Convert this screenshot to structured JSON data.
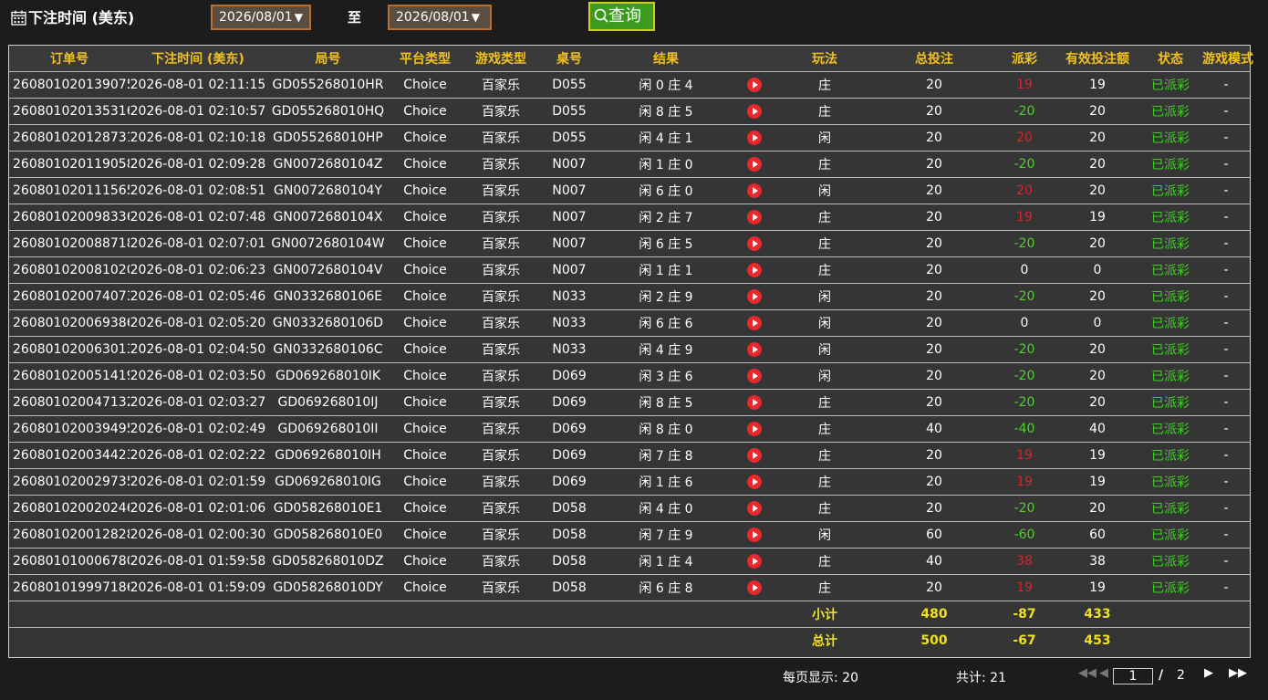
{
  "filter": {
    "label": "下注时间 (美东)",
    "start_date": "2026/08/01",
    "to_label": "至",
    "end_date": "2026/08/01",
    "query_label": "查询"
  },
  "table": {
    "headers": [
      "订单号",
      "下注时间 (美东)",
      "局号",
      "平台类型",
      "游戏类型",
      "桌号",
      "结果",
      "",
      "玩法",
      "总投注",
      "派彩",
      "有效投注额",
      "状态",
      "游戏模式"
    ],
    "rows": [
      [
        "260801020139075",
        "2026-08-01 02:11:15",
        "GD055268010HR",
        "Choice",
        "百家乐",
        "D055",
        "闲 0 庄 4",
        "",
        "庄",
        "20",
        "19",
        "19",
        "已派彩",
        "-"
      ],
      [
        "260801020135316",
        "2026-08-01 02:10:57",
        "GD055268010HQ",
        "Choice",
        "百家乐",
        "D055",
        "闲 8 庄 5",
        "",
        "庄",
        "20",
        "-20",
        "20",
        "已派彩",
        "-"
      ],
      [
        "260801020128731",
        "2026-08-01 02:10:18",
        "GD055268010HP",
        "Choice",
        "百家乐",
        "D055",
        "闲 4 庄 1",
        "",
        "闲",
        "20",
        "20",
        "20",
        "已派彩",
        "-"
      ],
      [
        "260801020119058",
        "2026-08-01 02:09:28",
        "GN0072680104Z",
        "Choice",
        "百家乐",
        "N007",
        "闲 1 庄 0",
        "",
        "庄",
        "20",
        "-20",
        "20",
        "已派彩",
        "-"
      ],
      [
        "260801020111565",
        "2026-08-01 02:08:51",
        "GN0072680104Y",
        "Choice",
        "百家乐",
        "N007",
        "闲 6 庄 0",
        "",
        "闲",
        "20",
        "20",
        "20",
        "已派彩",
        "-"
      ],
      [
        "260801020098336",
        "2026-08-01 02:07:48",
        "GN0072680104X",
        "Choice",
        "百家乐",
        "N007",
        "闲 2 庄 7",
        "",
        "庄",
        "20",
        "19",
        "19",
        "已派彩",
        "-"
      ],
      [
        "260801020088718",
        "2026-08-01 02:07:01",
        "GN0072680104W",
        "Choice",
        "百家乐",
        "N007",
        "闲 6 庄 5",
        "",
        "庄",
        "20",
        "-20",
        "20",
        "已派彩",
        "-"
      ],
      [
        "260801020081020",
        "2026-08-01 02:06:23",
        "GN0072680104V",
        "Choice",
        "百家乐",
        "N007",
        "闲 1 庄 1",
        "",
        "庄",
        "20",
        "0",
        "0",
        "已派彩",
        "-"
      ],
      [
        "260801020074073",
        "2026-08-01 02:05:46",
        "GN0332680106E",
        "Choice",
        "百家乐",
        "N033",
        "闲 2 庄 9",
        "",
        "闲",
        "20",
        "-20",
        "20",
        "已派彩",
        "-"
      ],
      [
        "260801020069386",
        "2026-08-01 02:05:20",
        "GN0332680106D",
        "Choice",
        "百家乐",
        "N033",
        "闲 6 庄 6",
        "",
        "闲",
        "20",
        "0",
        "0",
        "已派彩",
        "-"
      ],
      [
        "260801020063013",
        "2026-08-01 02:04:50",
        "GN0332680106C",
        "Choice",
        "百家乐",
        "N033",
        "闲 4 庄 9",
        "",
        "闲",
        "20",
        "-20",
        "20",
        "已派彩",
        "-"
      ],
      [
        "260801020051419",
        "2026-08-01 02:03:50",
        "GD069268010IK",
        "Choice",
        "百家乐",
        "D069",
        "闲 3 庄 6",
        "",
        "闲",
        "20",
        "-20",
        "20",
        "已派彩",
        "-"
      ],
      [
        "260801020047132",
        "2026-08-01 02:03:27",
        "GD069268010IJ",
        "Choice",
        "百家乐",
        "D069",
        "闲 8 庄 5",
        "",
        "庄",
        "20",
        "-20",
        "20",
        "已派彩",
        "-"
      ],
      [
        "260801020039495",
        "2026-08-01 02:02:49",
        "GD069268010II",
        "Choice",
        "百家乐",
        "D069",
        "闲 8 庄 0",
        "",
        "庄",
        "40",
        "-40",
        "40",
        "已派彩",
        "-"
      ],
      [
        "260801020034423",
        "2026-08-01 02:02:22",
        "GD069268010IH",
        "Choice",
        "百家乐",
        "D069",
        "闲 7 庄 8",
        "",
        "庄",
        "20",
        "19",
        "19",
        "已派彩",
        "-"
      ],
      [
        "260801020029735",
        "2026-08-01 02:01:59",
        "GD069268010IG",
        "Choice",
        "百家乐",
        "D069",
        "闲 1 庄 6",
        "",
        "庄",
        "20",
        "19",
        "19",
        "已派彩",
        "-"
      ],
      [
        "260801020020246",
        "2026-08-01 02:01:06",
        "GD058268010E1",
        "Choice",
        "百家乐",
        "D058",
        "闲 4 庄 0",
        "",
        "庄",
        "20",
        "-20",
        "20",
        "已派彩",
        "-"
      ],
      [
        "260801020012828",
        "2026-08-01 02:00:30",
        "GD058268010E0",
        "Choice",
        "百家乐",
        "D058",
        "闲 7 庄 9",
        "",
        "闲",
        "60",
        "-60",
        "60",
        "已派彩",
        "-"
      ],
      [
        "260801010006780",
        "2026-08-01 01:59:58",
        "GD058268010DZ",
        "Choice",
        "百家乐",
        "D058",
        "闲 1 庄 4",
        "",
        "庄",
        "40",
        "38",
        "38",
        "已派彩",
        "-"
      ],
      [
        "260801019997186",
        "2026-08-01 01:59:09",
        "GD058268010DY",
        "Choice",
        "百家乐",
        "D058",
        "闲 6 庄 8",
        "",
        "庄",
        "20",
        "19",
        "19",
        "已派彩",
        "-"
      ]
    ],
    "subtotal": {
      "label": "小计",
      "total_bet": "480",
      "payout": "-87",
      "valid_bet": "433"
    },
    "grand_total": {
      "label": "总计",
      "total_bet": "500",
      "payout": "-67",
      "valid_bet": "453"
    }
  },
  "pagination": {
    "per_page": "每页显示: 20",
    "total": "共计: 21",
    "current_page": "1",
    "slash": "/",
    "total_pages": "2"
  },
  "colors": {
    "header_text": "#f0c020",
    "payout_negative": "#4cd02c",
    "payout_positive": "#d8242e",
    "status_paid": "#3ed020",
    "summary_text": "#f0e020",
    "query_button": "#3c9a1e"
  },
  "icons": {
    "calendar": "calendar-icon",
    "search": "search-icon",
    "replay": "play-icon",
    "first_page": "first-page-icon",
    "prev_page": "prev-page-icon",
    "next_page": "next-page-icon",
    "last_page": "last-page-icon"
  }
}
